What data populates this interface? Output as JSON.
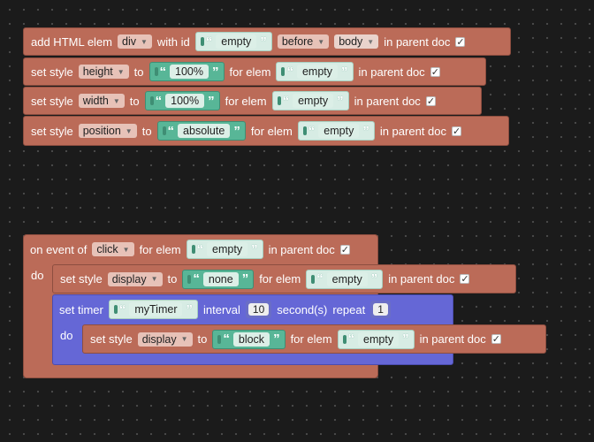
{
  "block_add_html": {
    "text_add": "add HTML elem",
    "elem_type": "div",
    "text_with_id": "with id",
    "id_value": "empty",
    "position": "before",
    "target": "body",
    "text_parent": "in parent doc"
  },
  "style_blocks": [
    {
      "text_set": "set style",
      "property": "height",
      "text_to": "to",
      "value": "100%",
      "text_for": "for elem",
      "elem": "empty",
      "text_parent": "in parent doc"
    },
    {
      "text_set": "set style",
      "property": "width",
      "text_to": "to",
      "value": "100%",
      "text_for": "for elem",
      "elem": "empty",
      "text_parent": "in parent doc"
    },
    {
      "text_set": "set style",
      "property": "position",
      "text_to": "to",
      "value": "absolute",
      "text_for": "for elem",
      "elem": "empty",
      "text_parent": "in parent doc"
    }
  ],
  "event_block": {
    "text_on": "on event of",
    "event": "click",
    "text_for": "for elem",
    "elem": "empty",
    "text_parent": "in parent doc",
    "text_do": "do",
    "inner_style": {
      "text_set": "set style",
      "property": "display",
      "text_to": "to",
      "value": "none",
      "text_for": "for elem",
      "elem": "empty",
      "text_parent": "in parent doc"
    },
    "timer": {
      "text_set": "set timer",
      "name": "myTimer",
      "text_interval": "interval",
      "interval": "10",
      "text_seconds": "second(s)",
      "text_repeat": "repeat",
      "repeat": "1",
      "text_do": "do",
      "inner_style": {
        "text_set": "set style",
        "property": "display",
        "text_to": "to",
        "value": "block",
        "text_for": "for elem",
        "elem": "empty",
        "text_parent": "in parent doc"
      }
    }
  },
  "icons": {
    "dropdown": "triangle-down-icon",
    "checkbox": "checkmark-icon",
    "quote": "quote-icon"
  }
}
